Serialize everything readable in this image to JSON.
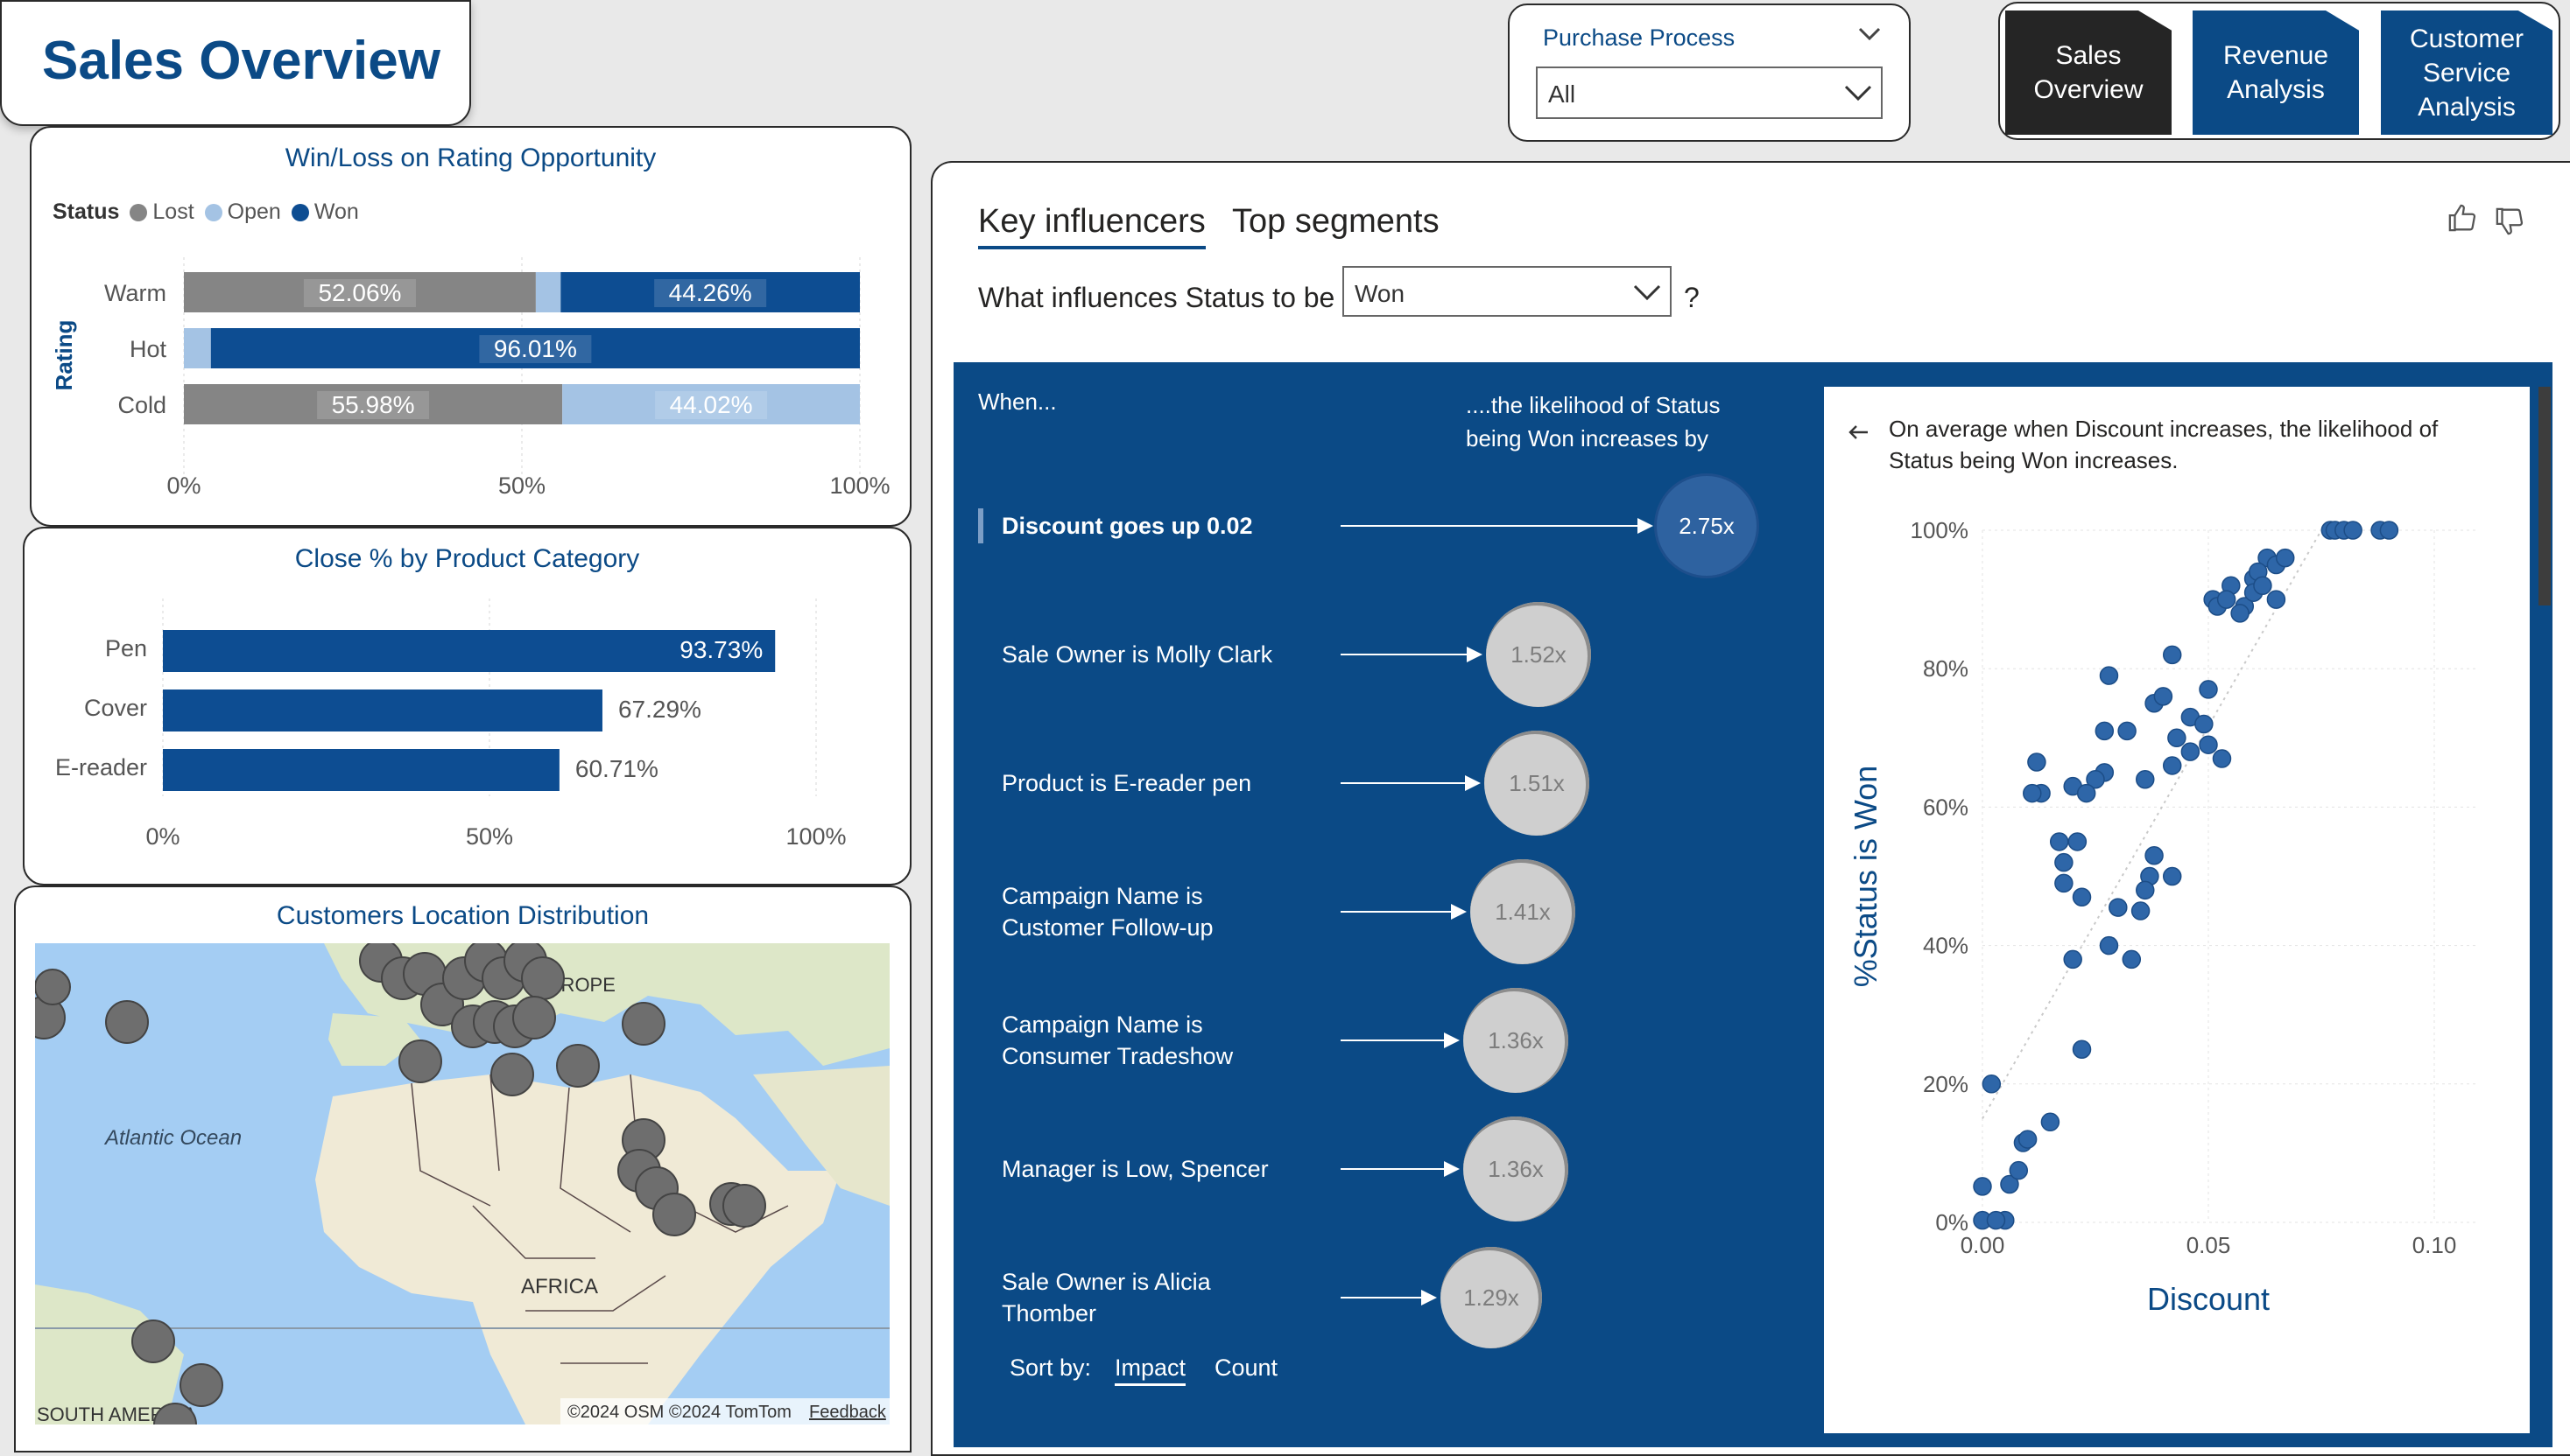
{
  "header": {
    "title": "Sales Overview"
  },
  "filter": {
    "label": "Purchase Process",
    "value": "All"
  },
  "nav": [
    {
      "line1": "Sales",
      "line2": "Overview",
      "line3": ""
    },
    {
      "line1": "Revenue",
      "line2": "Analysis",
      "line3": ""
    },
    {
      "line1": "Customer",
      "line2": "Service",
      "line3": "Analysis"
    }
  ],
  "winloss": {
    "title": "Win/Loss on Rating Opportunity",
    "legend_title": "Status",
    "legend": [
      {
        "name": "Lost",
        "color": "#858585"
      },
      {
        "name": "Open",
        "color": "#a4c3e4"
      },
      {
        "name": "Won",
        "color": "#0d4d92"
      }
    ],
    "axis_label": "Rating",
    "ticks": [
      "0%",
      "50%",
      "100%"
    ]
  },
  "close_pct": {
    "title": "Close % by Product Category",
    "ticks": [
      "0%",
      "50%",
      "100%"
    ]
  },
  "map": {
    "title": "Customers Location Distribution",
    "labels": {
      "ocean": "Atlantic Ocean",
      "europe": "EUROPE",
      "africa": "AFRICA",
      "south_america": "SOUTH AMERICA"
    },
    "attribution": "©2024 OSM ©2024 TomTom",
    "feedback": "Feedback"
  },
  "influencers": {
    "tabs": [
      "Key influencers",
      "Top segments"
    ],
    "question_prefix": "What influences Status to be",
    "question_value": "Won",
    "question_suffix": "?",
    "col_when": "When...",
    "col_likelihood_1": "....the likelihood of Status",
    "col_likelihood_2": "being Won increases by",
    "rows": [
      {
        "line1": "Discount goes up 0.02",
        "line2": "",
        "value": "2.75x"
      },
      {
        "line1": "Sale Owner is Molly Clark",
        "line2": "",
        "value": "1.52x"
      },
      {
        "line1": "Product is E-reader pen",
        "line2": "",
        "value": "1.51x"
      },
      {
        "line1": "Campaign Name is",
        "line2": "Customer Follow-up",
        "value": "1.41x"
      },
      {
        "line1": "Campaign Name is",
        "line2": "Consumer Tradeshow",
        "value": "1.36x"
      },
      {
        "line1": "Manager is Low, Spencer",
        "line2": "",
        "value": "1.36x"
      },
      {
        "line1": "Sale Owner is Alicia",
        "line2": "Thomber",
        "value": "1.29x"
      }
    ],
    "sort_label": "Sort by:",
    "sort_options": [
      "Impact",
      "Count"
    ],
    "detail_text_1": "On average when Discount increases, the likelihood of",
    "detail_text_2": "Status being Won increases."
  },
  "chart_data": [
    {
      "type": "bar",
      "title": "Win/Loss on Rating Opportunity",
      "stacked": "100%",
      "categories": [
        "Warm",
        "Hot",
        "Cold"
      ],
      "series": [
        {
          "name": "Lost",
          "values": [
            52.06,
            0,
            55.98
          ]
        },
        {
          "name": "Open",
          "values": [
            3.68,
            3.99,
            44.02
          ]
        },
        {
          "name": "Won",
          "values": [
            44.26,
            96.01,
            0
          ]
        }
      ],
      "data_labels": [
        [
          "52.06%",
          "",
          "44.26%"
        ],
        [
          "",
          "",
          "96.01%"
        ],
        [
          "55.98%",
          "44.02%",
          ""
        ]
      ],
      "ylabel": "Rating",
      "xlim": [
        0,
        100
      ]
    },
    {
      "type": "bar",
      "title": "Close % by Product Category",
      "categories": [
        "Pen",
        "Cover",
        "E-reader"
      ],
      "values": [
        93.73,
        67.29,
        60.71
      ],
      "data_labels": [
        "93.73%",
        "67.29%",
        "60.71%"
      ],
      "xlim": [
        0,
        100
      ]
    },
    {
      "type": "scatter",
      "xlabel": "Discount",
      "ylabel": "%Status is Won",
      "xlim": [
        0,
        0.1
      ],
      "ylim": [
        0,
        100
      ],
      "xticks": [
        "0.00",
        "0.05",
        "0.10"
      ],
      "yticks": [
        "0%",
        "20%",
        "40%",
        "60%",
        "80%",
        "100%"
      ],
      "trend": [
        [
          0,
          15
        ],
        [
          0.075,
          100
        ]
      ],
      "x": [
        0.0,
        0.0,
        0.005,
        0.006,
        0.002,
        0.008,
        0.009,
        0.01,
        0.015,
        0.003,
        0.022,
        0.02,
        0.028,
        0.033,
        0.03,
        0.035,
        0.037,
        0.038,
        0.036,
        0.042,
        0.017,
        0.021,
        0.018,
        0.022,
        0.012,
        0.013,
        0.02,
        0.027,
        0.032,
        0.028,
        0.036,
        0.027,
        0.025,
        0.023,
        0.011,
        0.018,
        0.038,
        0.042,
        0.04,
        0.046,
        0.05,
        0.053,
        0.055,
        0.051,
        0.05,
        0.046,
        0.042,
        0.049,
        0.043,
        0.052,
        0.054,
        0.058,
        0.06,
        0.06,
        0.057,
        0.063,
        0.065,
        0.061,
        0.062,
        0.065,
        0.067,
        0.077,
        0.078,
        0.08,
        0.082,
        0.088,
        0.09
      ],
      "y": [
        0.3,
        5.2,
        0.3,
        5.5,
        20,
        7.5,
        11.5,
        12,
        14.5,
        0.3,
        25,
        38,
        40,
        38,
        45.5,
        45,
        50,
        53,
        48,
        50,
        55,
        55,
        52,
        47,
        66.5,
        62,
        63,
        71,
        71,
        79,
        64,
        65,
        64,
        62,
        62,
        49,
        75,
        82,
        76,
        73,
        77,
        67,
        92,
        90,
        69,
        68,
        66,
        72,
        70,
        89,
        90,
        89,
        93,
        91,
        88,
        96,
        95,
        94,
        92,
        90,
        96,
        100,
        100,
        100,
        100,
        100,
        100
      ]
    }
  ]
}
